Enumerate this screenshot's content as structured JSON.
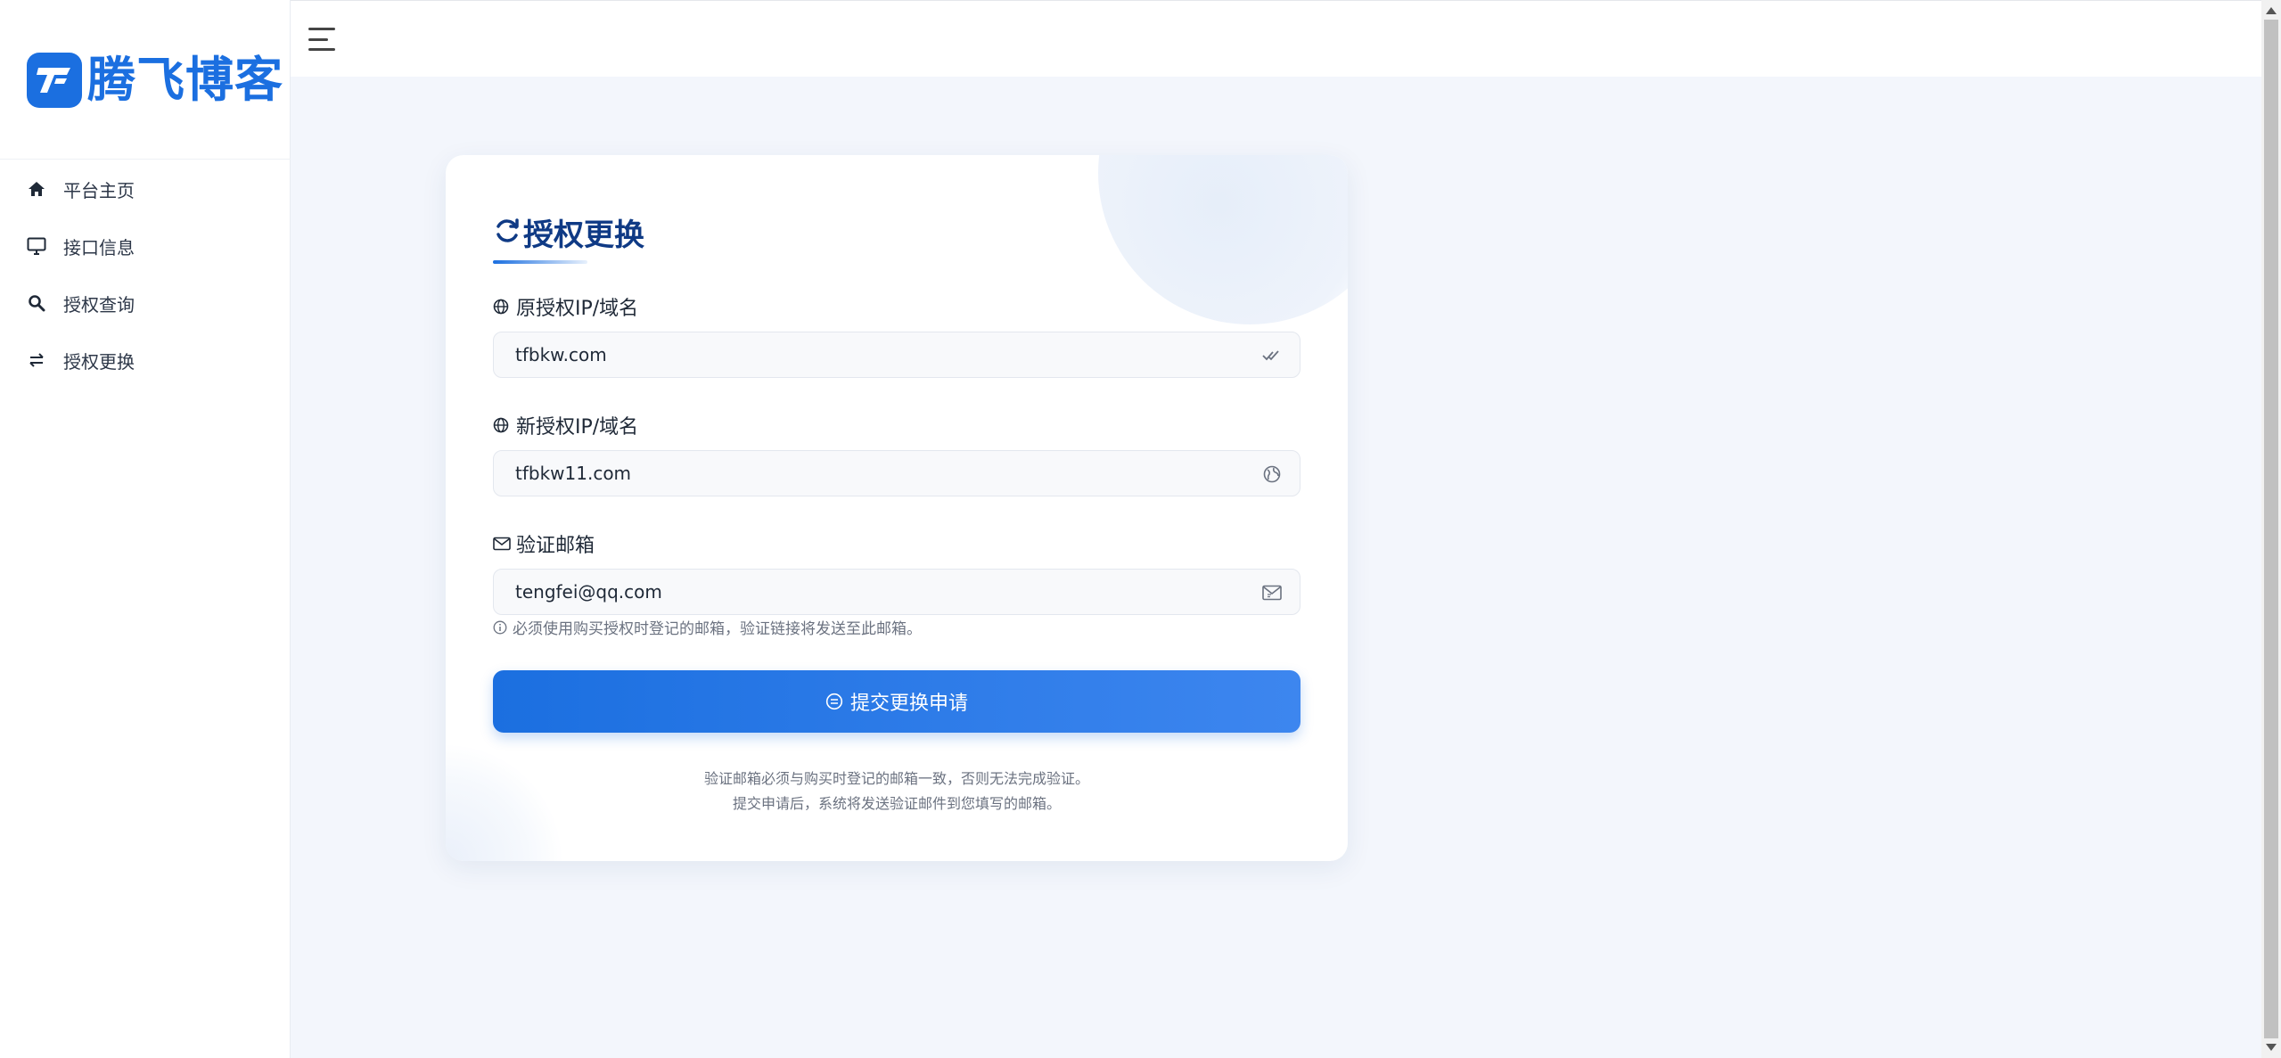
{
  "brand": {
    "name": "腾飞博客",
    "logo_letter": "F",
    "color": "#1b6fe0"
  },
  "sidebar": {
    "items": [
      {
        "label": "平台主页",
        "icon": "home-icon"
      },
      {
        "label": "接口信息",
        "icon": "monitor-icon"
      },
      {
        "label": "授权查询",
        "icon": "search-icon"
      },
      {
        "label": "授权更换",
        "icon": "swap-icon"
      }
    ]
  },
  "header": {
    "menu_icon": "hamburger-menu-icon"
  },
  "form": {
    "title": "授权更换",
    "title_icon": "refresh-icon",
    "fields": [
      {
        "label": "原授权IP/域名",
        "value": "tfbkw.com",
        "label_icon": "globe-icon",
        "input_icon": "check-double-icon"
      },
      {
        "label": "新授权IP/域名",
        "value": "tfbkw11.com",
        "label_icon": "globe-icon",
        "input_icon": "globe-filled-icon"
      },
      {
        "label": "验证邮箱",
        "value": "tengfei@qq.com",
        "label_icon": "mail-icon",
        "input_icon": "mail-icon"
      }
    ],
    "email_hint": "必须使用购买授权时登记的邮箱，验证链接将发送至此邮箱。",
    "submit_label": "提交更换申请",
    "notes": [
      "验证邮箱必须与购买时登记的邮箱一致，否则无法完成验证。",
      "提交申请后，系统将发送验证邮件到您填写的邮箱。"
    ]
  }
}
